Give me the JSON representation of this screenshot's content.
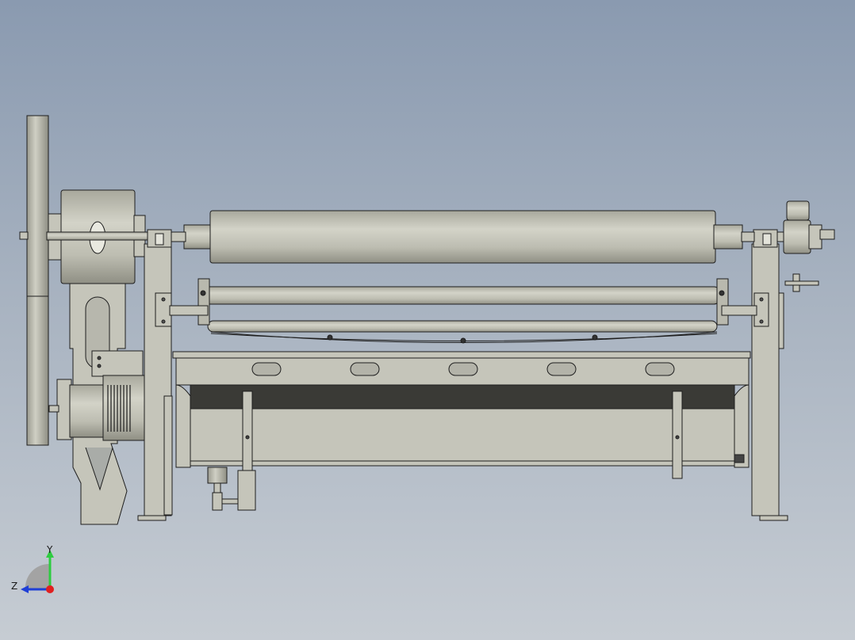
{
  "view": {
    "axes": {
      "y_label": "Y",
      "z_label": "Z"
    },
    "colors": {
      "background_top": "#8a9ab0",
      "background_bottom": "#c6ccd3",
      "part_fill": "#c5c5ba",
      "part_dark": "#3a3a36",
      "outline": "#1e1e1e",
      "axis_y": "#2ecc40",
      "axis_z": "#1f3fd6",
      "axis_x": "#e02020"
    }
  }
}
